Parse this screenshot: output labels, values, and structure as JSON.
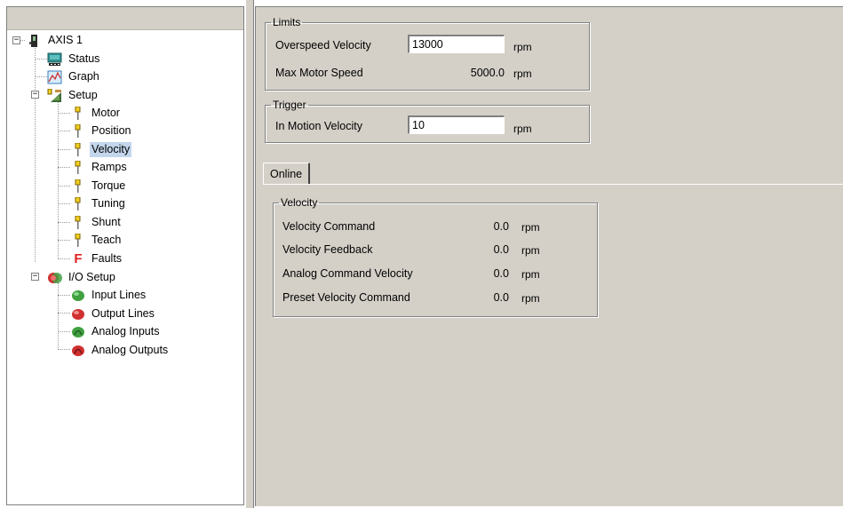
{
  "tree": {
    "root": "AXIS 1",
    "items": [
      {
        "label": "Status"
      },
      {
        "label": "Graph"
      },
      {
        "label": "Setup"
      },
      {
        "label": "Motor"
      },
      {
        "label": "Position"
      },
      {
        "label": "Velocity",
        "selected": true
      },
      {
        "label": "Ramps"
      },
      {
        "label": "Torque"
      },
      {
        "label": "Tuning"
      },
      {
        "label": "Shunt"
      },
      {
        "label": "Teach"
      },
      {
        "label": "Faults"
      },
      {
        "label": "I/O Setup"
      },
      {
        "label": "Input Lines"
      },
      {
        "label": "Output Lines"
      },
      {
        "label": "Analog Inputs"
      },
      {
        "label": "Analog Outputs"
      }
    ],
    "faults_glyph": "F"
  },
  "limits": {
    "legend": "Limits",
    "overspeed_label": "Overspeed Velocity",
    "overspeed_value": "13000",
    "overspeed_unit": "rpm",
    "max_motor_label": "Max Motor Speed",
    "max_motor_value": "5000.0",
    "max_motor_unit": "rpm"
  },
  "trigger": {
    "legend": "Trigger",
    "in_motion_label": "In Motion Velocity",
    "in_motion_value": "10",
    "in_motion_unit": "rpm"
  },
  "tabs": {
    "online": "Online"
  },
  "velocity": {
    "legend": "Velocity",
    "rows": [
      {
        "label": "Velocity Command",
        "value": "0.0",
        "unit": "rpm"
      },
      {
        "label": "Velocity Feedback",
        "value": "0.0",
        "unit": "rpm"
      },
      {
        "label": "Analog Command Velocity",
        "value": "0.0",
        "unit": "rpm"
      },
      {
        "label": "Preset Velocity Command",
        "value": "0.0",
        "unit": "rpm"
      }
    ]
  },
  "colors": {
    "panel": "#d4d0c8",
    "selection": "#c3d6ec",
    "green_io": "#3fa03f",
    "red_io": "#d03030",
    "faults_red": "#e02020"
  }
}
